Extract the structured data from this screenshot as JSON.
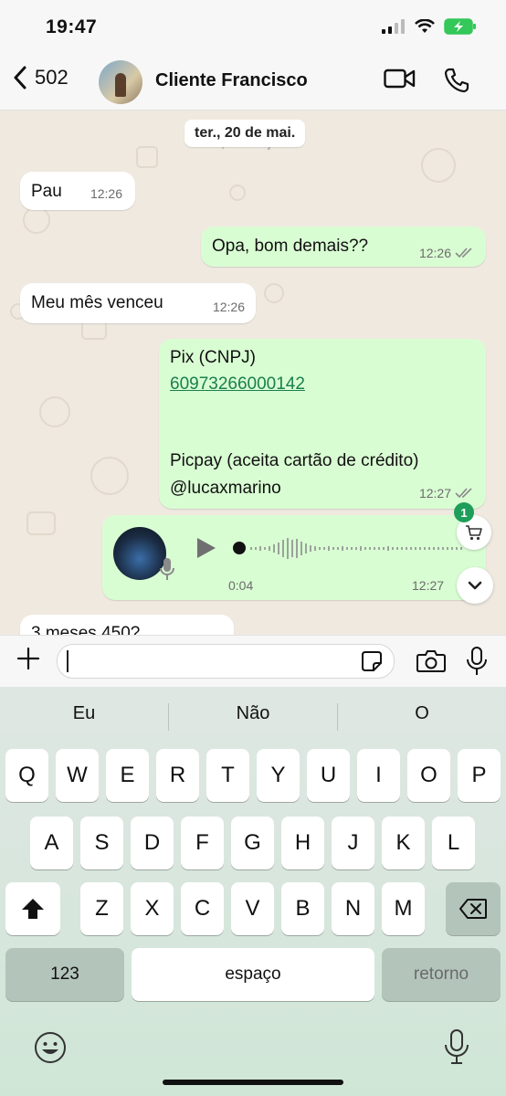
{
  "status_bar": {
    "time": "19:47"
  },
  "header": {
    "back_count": "502",
    "contact_name": "Cliente Francisco"
  },
  "chat": {
    "date_chip": "ter., 20 de mai.",
    "date_ghost": "sáb., 21 de jun.",
    "messages": [
      {
        "dir": "in",
        "text": "Pau",
        "time": "12:26"
      },
      {
        "dir": "out",
        "text": "Opa, bom demais??",
        "time": "12:26"
      },
      {
        "dir": "in",
        "text": "Meu mês venceu",
        "time": "12:26"
      },
      {
        "dir": "out",
        "line1": "Pix (CNPJ)",
        "link": "60973266000142",
        "line3": "Picpay (aceita cartão de crédito)",
        "line4": "@lucaxmarino",
        "time": "12:27"
      },
      {
        "dir": "out",
        "type": "voice",
        "duration": "0:04",
        "time": "12:27"
      },
      {
        "dir": "in",
        "text": "3 meses 450?",
        "partial": true
      }
    ],
    "cart_badge": "1"
  },
  "keyboard": {
    "suggestions": [
      "Eu",
      "Não",
      "O"
    ],
    "row1": [
      "Q",
      "W",
      "E",
      "R",
      "T",
      "Y",
      "U",
      "I",
      "O",
      "P"
    ],
    "row2": [
      "A",
      "S",
      "D",
      "F",
      "G",
      "H",
      "J",
      "K",
      "L"
    ],
    "row3": [
      "Z",
      "X",
      "C",
      "V",
      "B",
      "N",
      "M"
    ],
    "numbers_label": "123",
    "space_label": "espaço",
    "return_label": "retorno"
  }
}
